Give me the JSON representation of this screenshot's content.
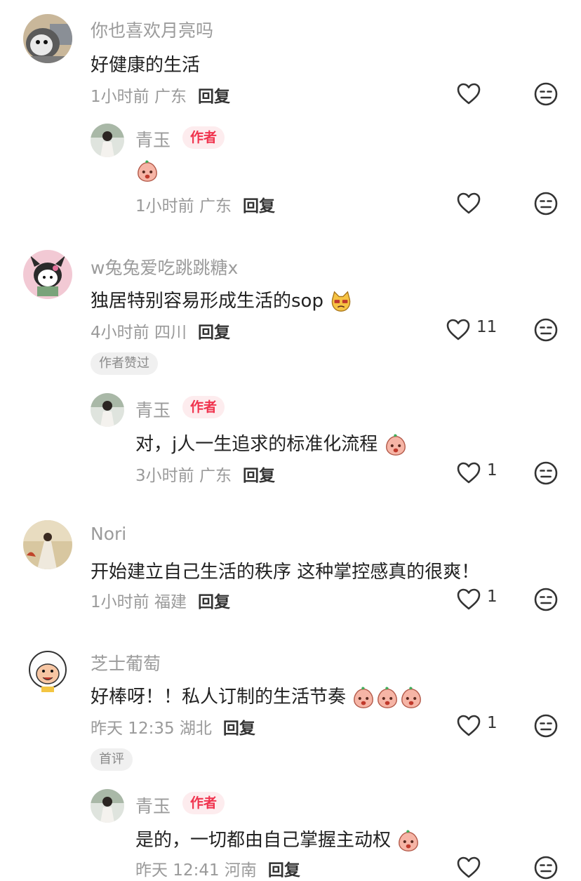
{
  "comments": [
    {
      "user": "你也喜欢月亮吗",
      "text": "好健康的生活",
      "meta": "1小时前 广东",
      "reply_label": "回复",
      "likes": "",
      "reply": {
        "user": "青玉",
        "badge": "作者",
        "text": "",
        "meta": "1小时前 广东",
        "reply_label": "回复",
        "likes": ""
      }
    },
    {
      "user": "w兔兔爱吃跳跳糖x",
      "text": "独居特别容易形成生活的sop",
      "meta": "4小时前 四川",
      "reply_label": "回复",
      "likes": "11",
      "tag": "作者赞过",
      "reply": {
        "user": "青玉",
        "badge": "作者",
        "text": "对，j人一生追求的标准化流程",
        "meta": "3小时前 广东",
        "reply_label": "回复",
        "likes": "1"
      }
    },
    {
      "user": "Nori",
      "text": "开始建立自己生活的秩序 这种掌控感真的很爽！",
      "meta": "1小时前 福建",
      "reply_label": "回复",
      "likes": "1"
    },
    {
      "user": "芝士葡萄",
      "text": "好棒呀！！私人订制的生活节奏",
      "meta": "昨天 12:35 湖北",
      "reply_label": "回复",
      "likes": "1",
      "tag": "首评",
      "reply": {
        "user": "青玉",
        "badge": "作者",
        "text": "是的，一切都由自己掌握主动权",
        "meta": "昨天 12:41 河南",
        "reply_label": "回复",
        "likes": ""
      }
    }
  ],
  "icons": {
    "like": "heart-outline-icon",
    "dislike": "meh-face-icon",
    "emoji": "peach-emoji-icon"
  },
  "colors": {
    "badge_text": "#f0334e",
    "badge_bg": "#fdecee",
    "muted": "#9a9a9a"
  }
}
